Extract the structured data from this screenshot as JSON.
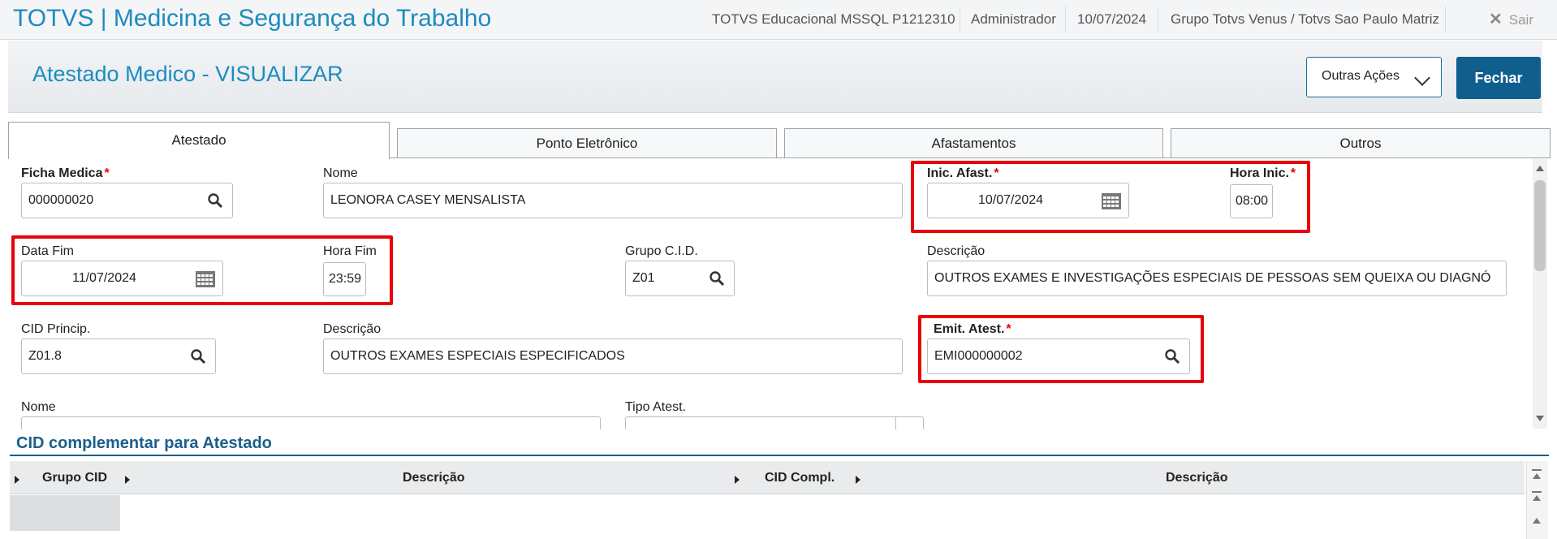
{
  "topbar": {
    "app_title": "TOTVS | Medicina e Segurança do Trabalho",
    "environment": "TOTVS Educacional MSSQL P1212310",
    "user": "Administrador",
    "date": "10/07/2024",
    "company": "Grupo Totvs Venus / Totvs Sao Paulo Matriz",
    "exit_label": "Sair"
  },
  "header": {
    "title": "Atestado Medico - VISUALIZAR",
    "other_actions_label": "Outras Ações",
    "close_label": "Fechar"
  },
  "tabs": [
    {
      "label": "Atestado",
      "active": true
    },
    {
      "label": "Ponto Eletrônico",
      "active": false
    },
    {
      "label": "Afastamentos",
      "active": false
    },
    {
      "label": "Outros",
      "active": false
    }
  ],
  "form": {
    "ficha_medica": {
      "label": "Ficha Medica",
      "value": "000000020",
      "required": true
    },
    "nome": {
      "label": "Nome",
      "value": "LEONORA CASEY MENSALISTA"
    },
    "inic_afast": {
      "label": "Inic. Afast.",
      "value": "10/07/2024",
      "required": true
    },
    "hora_inic": {
      "label": "Hora Inic.",
      "value": "08:00",
      "required": true
    },
    "data_fim": {
      "label": "Data Fim",
      "value": "11/07/2024"
    },
    "hora_fim": {
      "label": "Hora Fim",
      "value": "23:59"
    },
    "grupo_cid": {
      "label": "Grupo C.I.D.",
      "value": "Z01"
    },
    "descricao_grupo": {
      "label": "Descrição",
      "value": "OUTROS EXAMES E INVESTIGAÇÕES ESPECIAIS DE PESSOAS SEM QUEIXA OU DIAGNÓ"
    },
    "cid_princip": {
      "label": "CID Princip.",
      "value": "Z01.8"
    },
    "descricao_cid": {
      "label": "Descrição",
      "value": "OUTROS EXAMES ESPECIAIS ESPECIFICADOS"
    },
    "emit_atest": {
      "label": "Emit. Atest.",
      "value": "EMI000000002",
      "required": true
    },
    "nome2": {
      "label": "Nome",
      "value": ""
    },
    "tipo_atest": {
      "label": "Tipo Atest.",
      "value": ""
    }
  },
  "cid_section": {
    "title": "CID complementar para Atestado",
    "columns": [
      "Grupo CID",
      "Descrição",
      "CID Compl.",
      "Descrição"
    ]
  },
  "colors": {
    "accent": "#1d8bbf",
    "primary_button": "#0f5e8e",
    "highlight_box": "#e8000b",
    "required_star": "#e60000"
  }
}
